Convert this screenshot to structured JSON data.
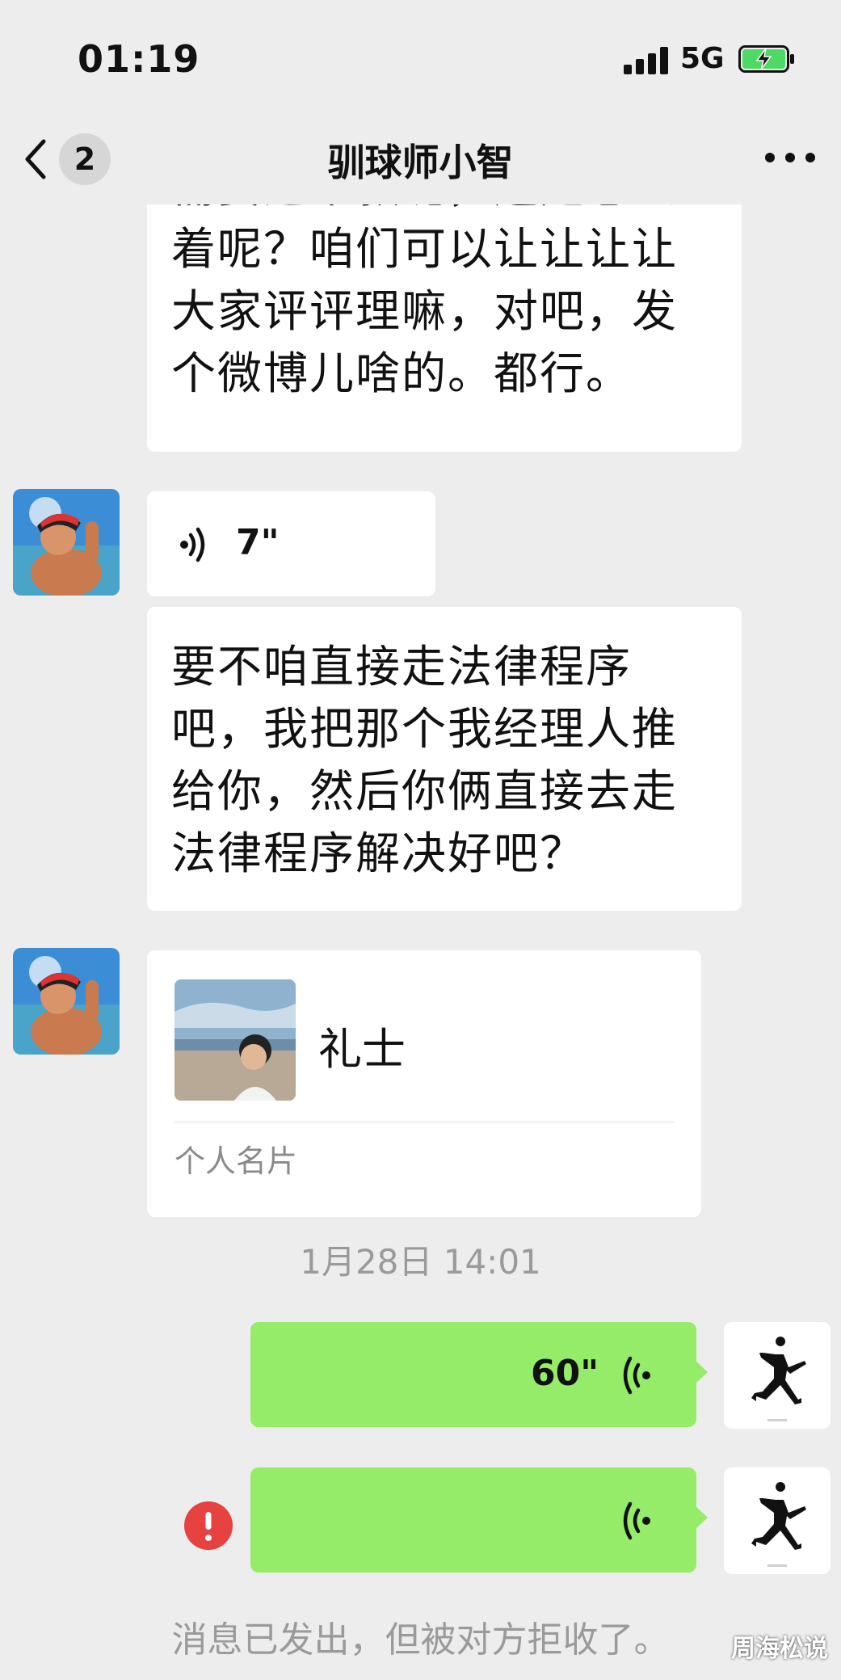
{
  "status_bar": {
    "time": "01:19",
    "network": "5G"
  },
  "nav": {
    "back_count": "2",
    "title": "驯球师小智"
  },
  "messages": {
    "first_tail": "需要这个款呢，还是怎么\n着呢？咱们可以让让让让\n大家评评理嘛，对吧，发\n个微博儿啥的。都行。",
    "voice_in": "7\"",
    "second": "要不咱直接走法律程序\n吧，我把那个我经理人推\n给你，然后你俩直接去走\n法律程序解决好吧？",
    "card_name": "礼士",
    "card_label": "个人名片",
    "timestamp": "1月28日 14:01",
    "voice_out_1": "60\"",
    "voice_out_2": "",
    "rejected_note": "消息已发出，但被对方拒收了。"
  },
  "watermark": "周海松说",
  "colors": {
    "bg": "#ededed",
    "bubble_out": "#95ec69",
    "error": "#e64340"
  }
}
